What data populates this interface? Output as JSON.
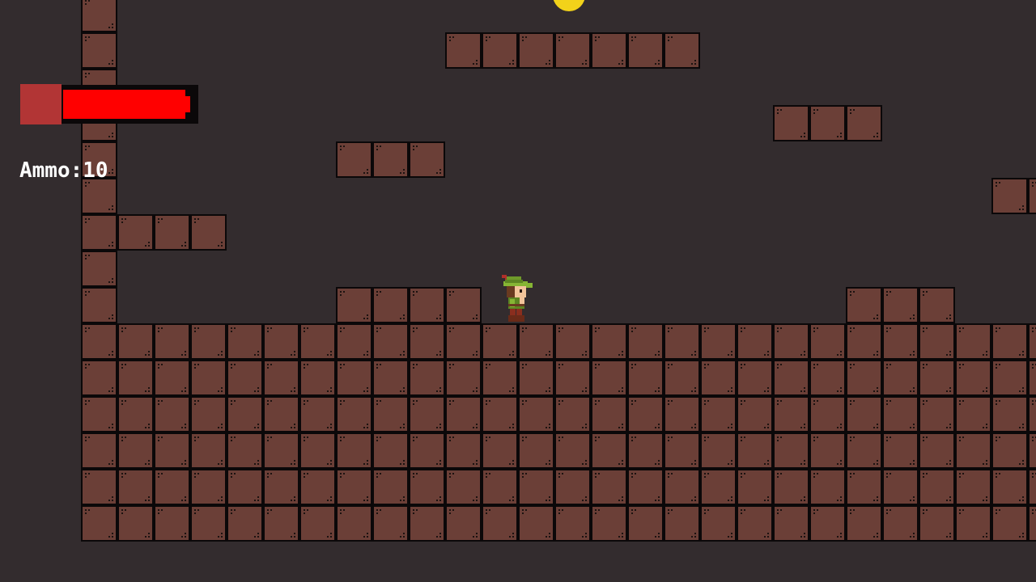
{
  "hud": {
    "ammo_label": "Ammo:",
    "ammo_count": "10",
    "health_fraction": 0.95
  },
  "colors": {
    "background": "#332c2e",
    "brick": "#6b3f37",
    "brick_outline": "#0b0809",
    "health_fill": "#ff0000",
    "health_cap": "#b23535",
    "coin": "#f2d21a",
    "text": "#ffffff"
  },
  "icons": {
    "player": "archer-character-icon",
    "coin": "coin-icon"
  }
}
